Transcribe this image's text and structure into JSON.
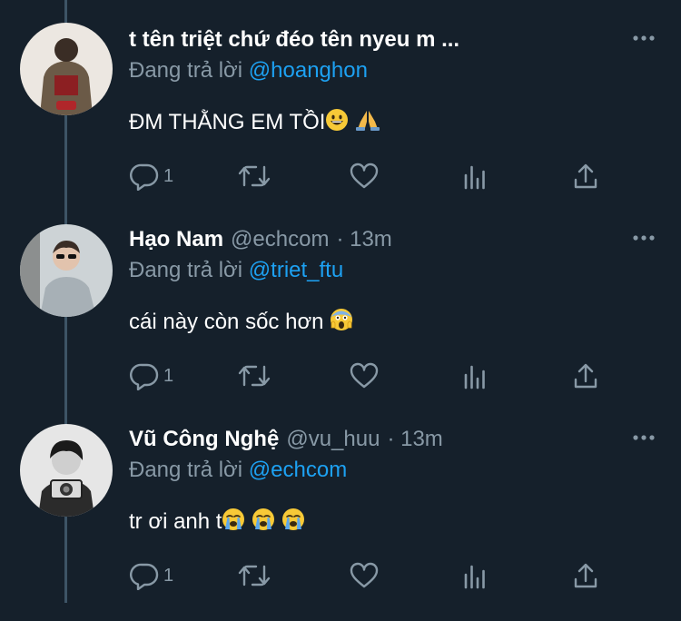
{
  "labels": {
    "replying_to": "Đang trả lời"
  },
  "colors": {
    "background": "#15202b",
    "muted": "#8899a6",
    "accent": "#1da1f2",
    "thread_line": "#3d5466"
  },
  "tweets": [
    {
      "name": "t tên triệt chứ đéo tên nyeu m ...",
      "handle": "",
      "time": "",
      "replying_to": "@hoanghon",
      "text": "ĐM THẰNG EM TỒI",
      "emojis": [
        "grinning-face",
        "folded-hands"
      ],
      "reply_count": "1"
    },
    {
      "name": "Hạo Nam",
      "handle": "@echcom",
      "time": "· 13m",
      "replying_to": "@triet_ftu",
      "text": "cái này còn sốc hơn",
      "emojis": [
        "screaming-face"
      ],
      "reply_count": "1"
    },
    {
      "name": "Vũ Công Nghệ",
      "handle": "@vu_huu",
      "time": "· 13m",
      "replying_to": "@echcom",
      "text": "tr ơi anh t",
      "emojis": [
        "loudly-crying-face",
        "loudly-crying-face",
        "loudly-crying-face"
      ],
      "reply_count": "1"
    }
  ]
}
